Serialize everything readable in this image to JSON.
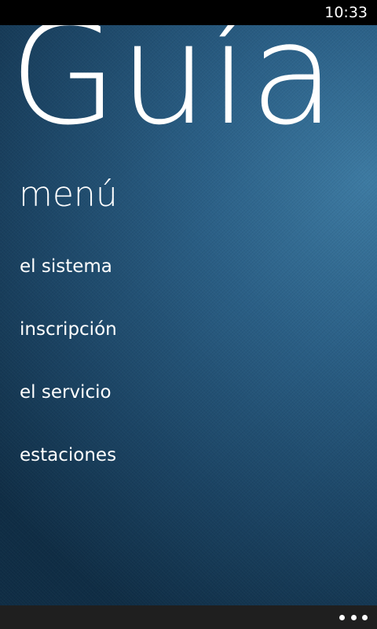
{
  "status_bar": {
    "time": "10:33"
  },
  "panorama": {
    "title": "Guía T"
  },
  "menu": {
    "header": "menú",
    "items": [
      {
        "label": "el sistema"
      },
      {
        "label": "inscripción"
      },
      {
        "label": "el servicio"
      },
      {
        "label": "estaciones"
      }
    ]
  },
  "app_bar": {
    "more_icon": "ellipsis-icon"
  },
  "colors": {
    "background_dark": "#0f2d45",
    "background_light": "#3d7ba3",
    "app_bar": "#1f1f1f",
    "text": "#ffffff"
  }
}
